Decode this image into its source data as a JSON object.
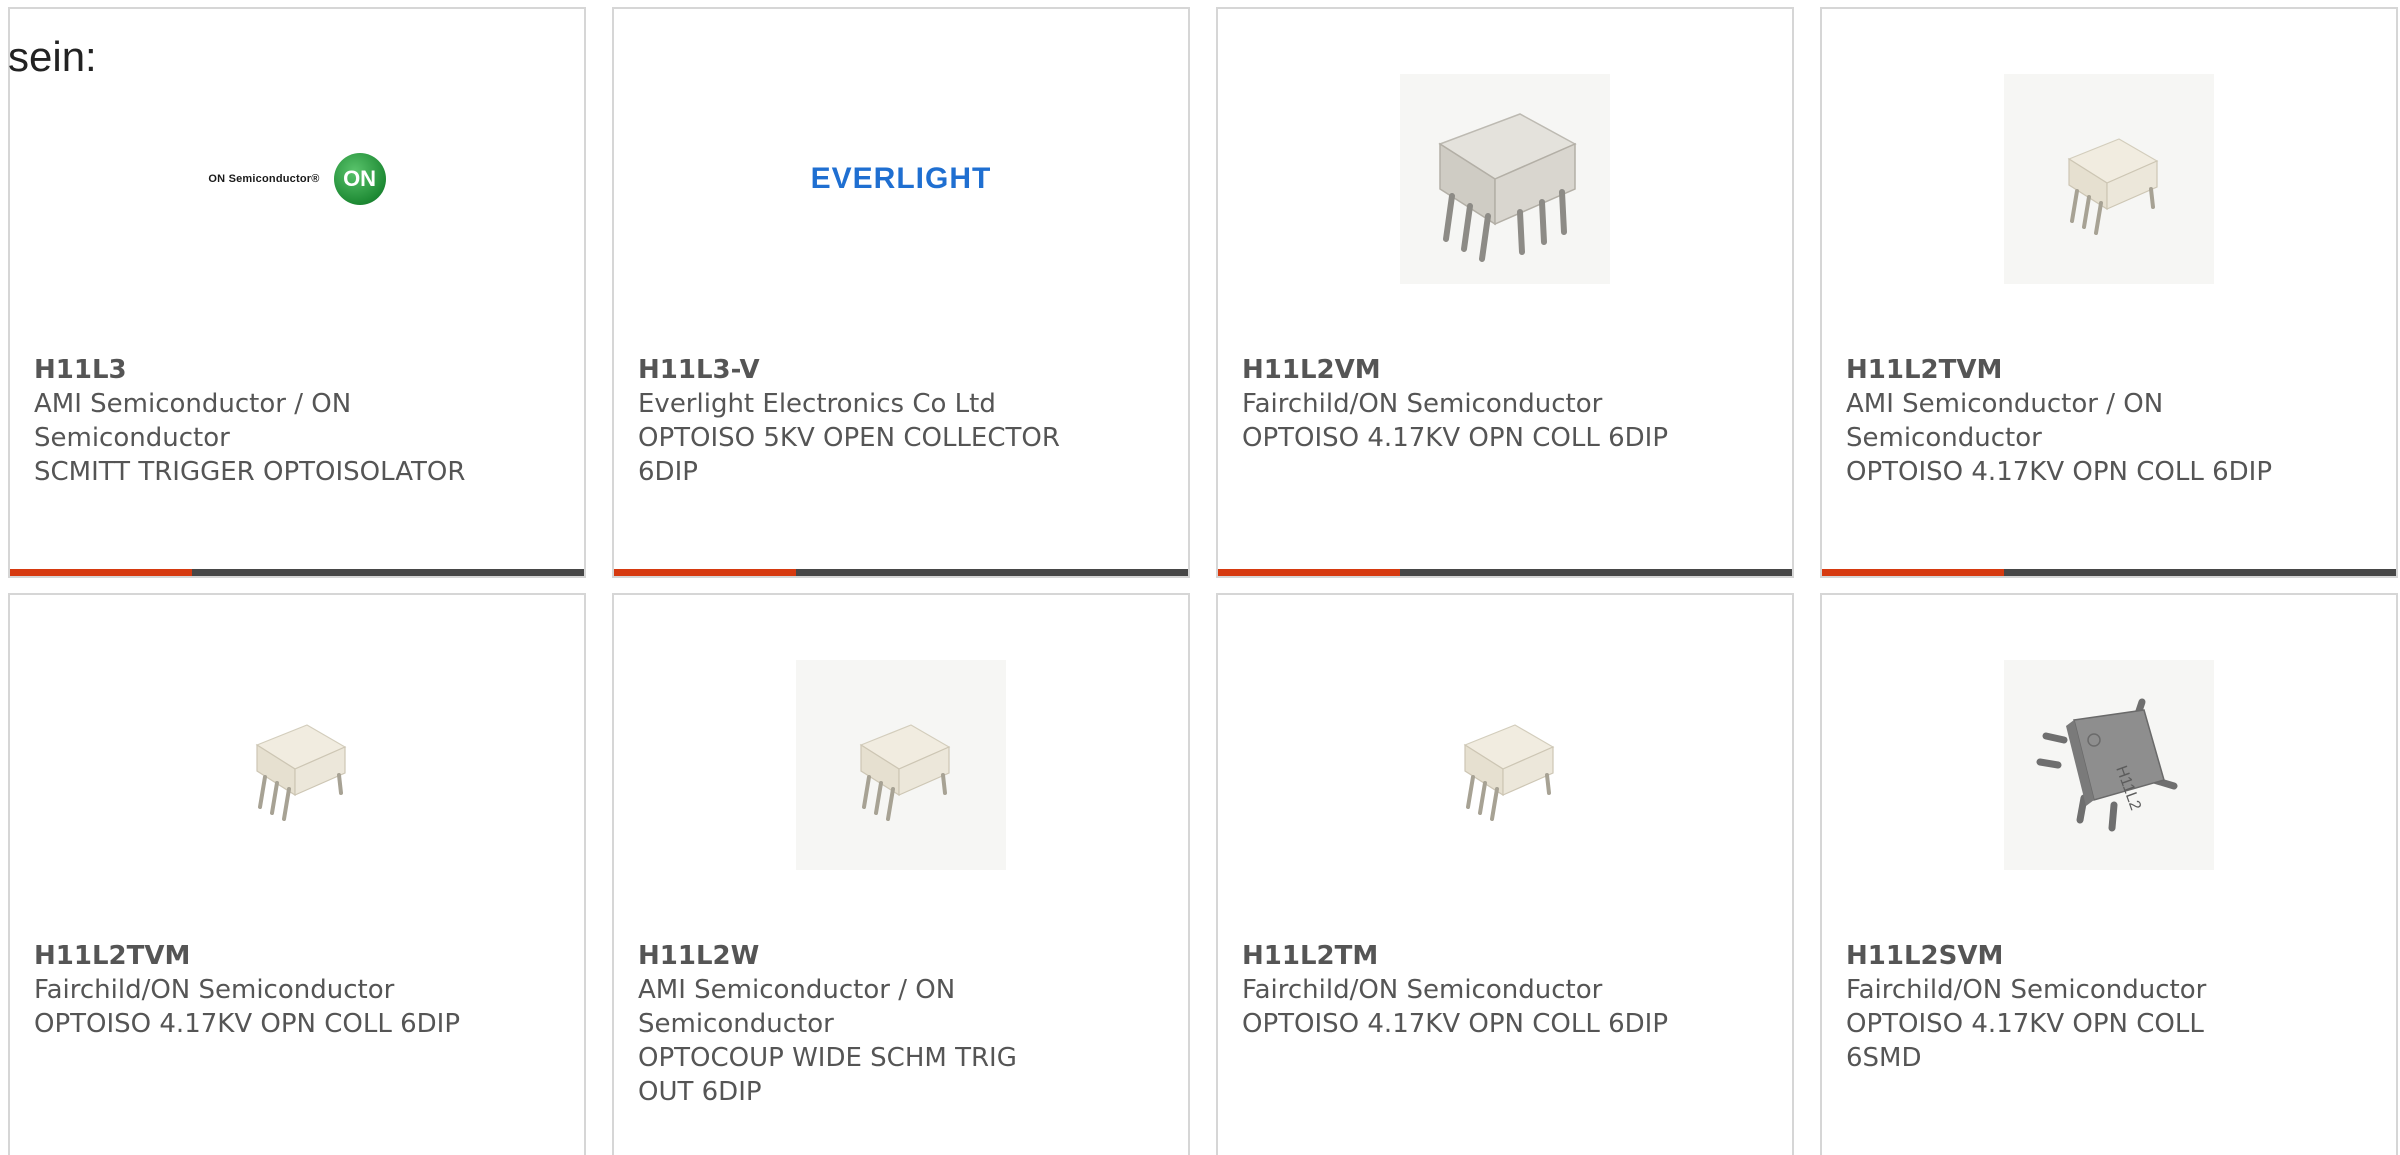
{
  "lead_text": "sein:",
  "colors": {
    "accent_bar": "#d63a10",
    "dark_bar": "#474747",
    "card_border": "#d6d6d6",
    "on_semi_green": "#1e8a34",
    "everlight_blue": "#1f6fd1"
  },
  "products": [
    {
      "part": "H11L3",
      "manufacturer": "AMI Semiconductor / ON Semiconductor",
      "description": "SCMITT TRIGGER OPTOISOLATOR",
      "image": "on-semiconductor-logo",
      "logo_text": "ON Semiconductor®",
      "logo_badge": "ON"
    },
    {
      "part": "H11L3-V",
      "manufacturer": "Everlight Electronics Co Ltd",
      "description": "OPTOISO 5KV OPEN COLLECTOR 6DIP",
      "image": "everlight-logo",
      "logo_text": "EVERLIGHT"
    },
    {
      "part": "H11L2VM",
      "manufacturer": "Fairchild/ON Semiconductor",
      "description": "OPTOISO 4.17KV OPN COLL 6DIP",
      "image": "dip6-chip-large-photo"
    },
    {
      "part": "H11L2TVM",
      "manufacturer": "AMI Semiconductor / ON Semiconductor",
      "description": "OPTOISO 4.17KV OPN COLL 6DIP",
      "image": "dip6-chip-photo"
    },
    {
      "part": "H11L2TVM",
      "manufacturer": "Fairchild/ON Semiconductor",
      "description": "OPTOISO 4.17KV OPN COLL 6DIP",
      "image": "dip6-chip-photo"
    },
    {
      "part": "H11L2W",
      "manufacturer": "AMI Semiconductor / ON Semiconductor",
      "description": "OPTOCOUP WIDE SCHM TRIG OUT 6DIP",
      "image": "dip6-chip-photo"
    },
    {
      "part": "H11L2TM",
      "manufacturer": "Fairchild/ON Semiconductor",
      "description": "OPTOISO 4.17KV OPN COLL 6DIP",
      "image": "dip6-chip-photo"
    },
    {
      "part": "H11L2SVM",
      "manufacturer": "Fairchild/ON Semiconductor",
      "description": "OPTOISO 4.17KV OPN COLL 6SMD",
      "image": "smd6-chip-photo",
      "chip_marking": "H11L2"
    }
  ]
}
